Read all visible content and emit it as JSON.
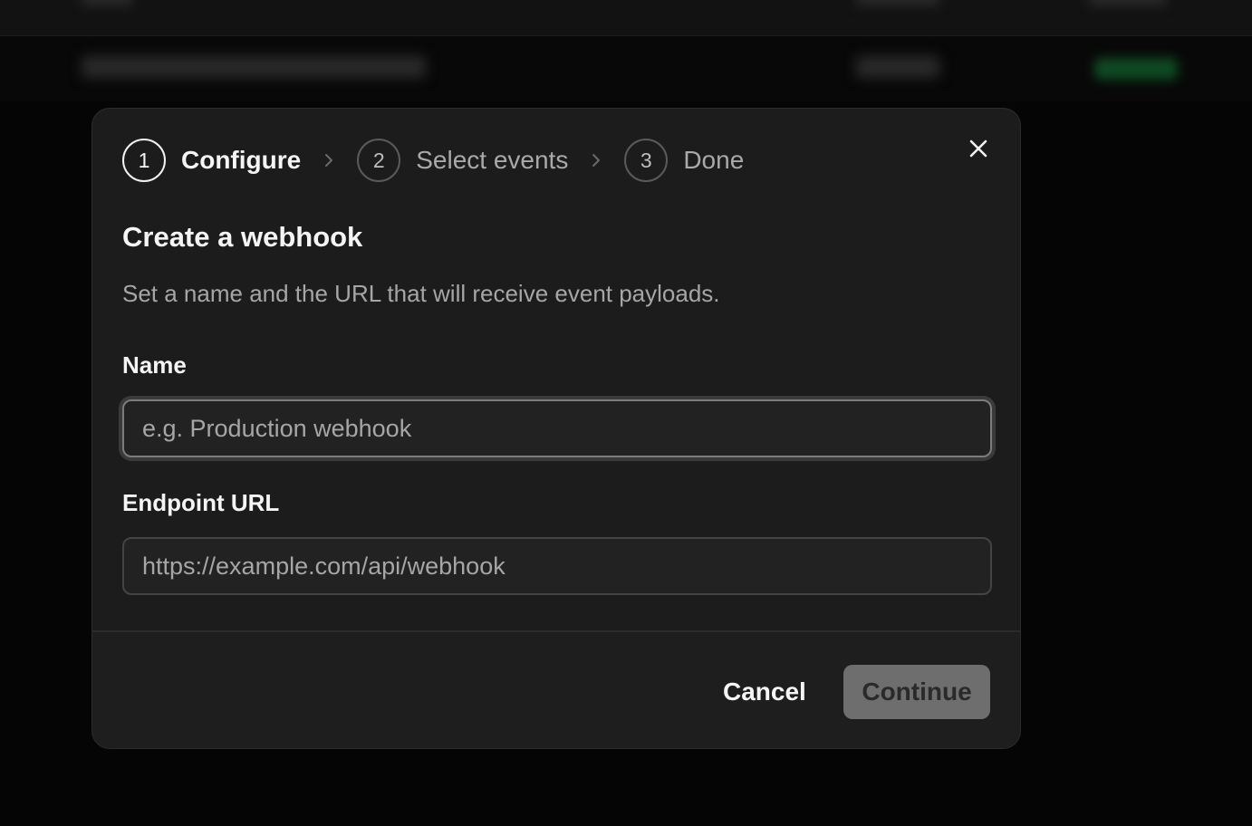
{
  "stepper": {
    "steps": [
      {
        "number": "1",
        "label": "Configure"
      },
      {
        "number": "2",
        "label": "Select events"
      },
      {
        "number": "3",
        "label": "Done"
      }
    ],
    "active_step": 1
  },
  "dialog": {
    "title": "Create a webhook",
    "subtitle": "Set a name and the URL that will receive event payloads."
  },
  "form": {
    "name": {
      "label": "Name",
      "placeholder": "e.g. Production webhook",
      "value": ""
    },
    "endpoint": {
      "label": "Endpoint URL",
      "placeholder": "https://example.com/api/webhook",
      "value": ""
    }
  },
  "footer": {
    "cancel_label": "Cancel",
    "continue_label": "Continue"
  },
  "colors": {
    "background": "#050505",
    "dialog": "#1c1c1c",
    "status_green": "#0f4a23",
    "continue_disabled": "#6e6e6e"
  },
  "icons": {
    "close": "close-icon",
    "step_separator": "chevron-right-icon"
  }
}
